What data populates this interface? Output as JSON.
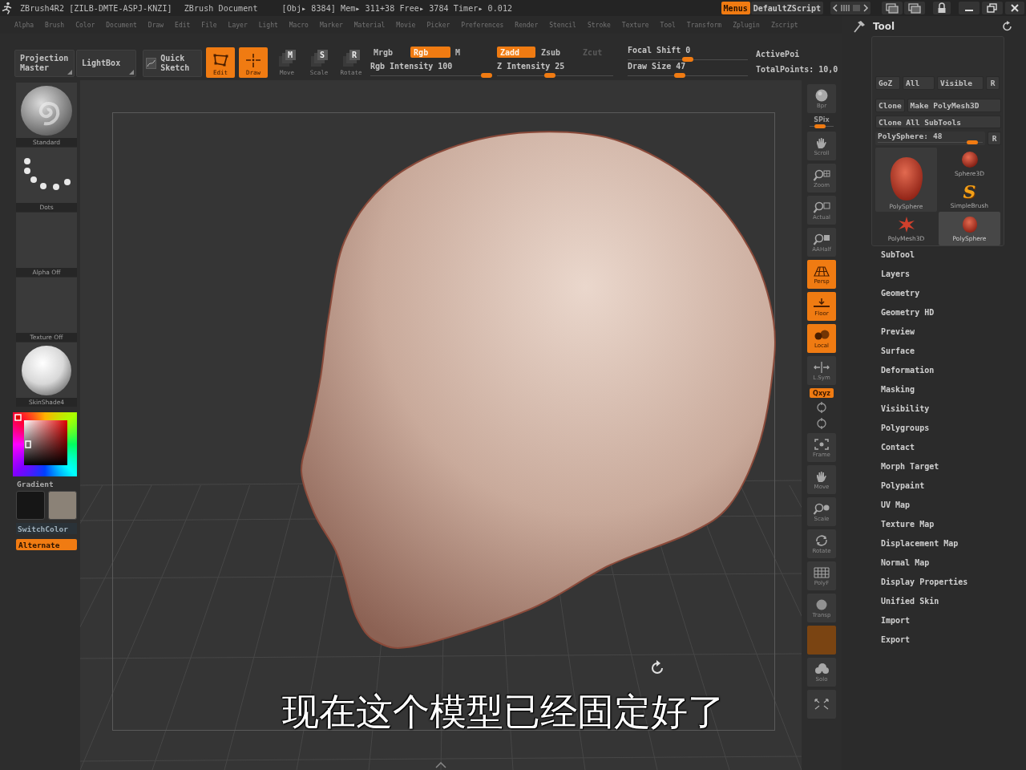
{
  "title_bar": {
    "app_title": "ZBrush4R2 [ZILB-DMTE-ASPJ-KNZI]",
    "document": "ZBrush Document",
    "stats": "[Obj▸ 8384] Mem▸ 311+38 Free▸ 3784 Timer▸ 0.012",
    "menus_toggle": {
      "label": "Menus",
      "on": true
    },
    "script_button": "DefaultZScript"
  },
  "menu_bar": [
    "Alpha",
    "Brush",
    "Color",
    "Document",
    "Draw",
    "Edit",
    "File",
    "Layer",
    "Light",
    "Macro",
    "Marker",
    "Material",
    "Movie",
    "Picker",
    "Preferences",
    "Render",
    "Stencil",
    "Stroke",
    "Texture",
    "Tool",
    "Transform",
    "Zplugin",
    "Zscript"
  ],
  "top_shelf": {
    "buttons": [
      {
        "kind": "panel",
        "label": "Projection Master"
      },
      {
        "kind": "panel",
        "label": "LightBox"
      },
      {
        "kind": "sketch",
        "label": "Quick Sketch"
      },
      {
        "kind": "mode",
        "label": "Edit",
        "on": true
      },
      {
        "kind": "mode",
        "label": "Draw",
        "on": true
      },
      {
        "kind": "transform",
        "glyph": "M",
        "label": "Move",
        "on": false
      },
      {
        "kind": "transform",
        "glyph": "S",
        "label": "Scale",
        "on": false
      },
      {
        "kind": "transform",
        "glyph": "R",
        "label": "Rotate",
        "on": false
      }
    ],
    "color_mode": {
      "toggles": [
        {
          "label": "Mrgb",
          "on": false
        },
        {
          "label": "Rgb",
          "on": true
        },
        {
          "label": "M",
          "on": false
        }
      ],
      "slider": {
        "label": "Rgb Intensity",
        "value": "100",
        "level": 1
      }
    },
    "depth_mode": {
      "toggles": [
        {
          "label": "Zadd",
          "on": true,
          "disabled": false
        },
        {
          "label": "Zsub",
          "on": false,
          "disabled": false
        },
        {
          "label": "Zcut",
          "on": false,
          "disabled": true
        }
      ],
      "slider": {
        "label": "Z Intensity",
        "value": "25",
        "level": 0.45
      }
    },
    "brush_sliders": [
      {
        "label": "Focal Shift",
        "value": "0",
        "level": 0.5
      },
      {
        "label": "Draw Size",
        "value": "47",
        "level": 0.43
      }
    ],
    "points": [
      "ActivePoi",
      "TotalPoints: 10,0"
    ]
  },
  "left_shelf": {
    "thumbnails": [
      {
        "kind": "brush",
        "label": "Standard"
      },
      {
        "kind": "stroke",
        "label": "Dots"
      },
      {
        "kind": "alpha",
        "label": "Alpha Off"
      },
      {
        "kind": "texture",
        "label": "Texture Off"
      },
      {
        "kind": "material",
        "label": "SkinShade4"
      }
    ],
    "gradient_button": "Gradient",
    "swatches": [
      {
        "color": "#161616"
      },
      {
        "color": "#8b8277"
      }
    ],
    "switch_color_button": "SwitchColor",
    "alternate_toggle": {
      "label": "Alternate",
      "on": true
    }
  },
  "canvas": {
    "subtitle": "现在这个模型已经固定好了"
  },
  "right_toolbar": [
    {
      "kind": "tile",
      "label": "Bpr",
      "on": false
    },
    {
      "kind": "slider",
      "label": "SPix",
      "level": 0.4
    },
    {
      "kind": "tile",
      "label": "Scroll",
      "on": false
    },
    {
      "kind": "tile",
      "label": "Zoom",
      "on": false
    },
    {
      "kind": "tile",
      "label": "Actual",
      "on": false
    },
    {
      "kind": "tile",
      "label": "AAHalf",
      "on": false
    },
    {
      "kind": "tile",
      "label": "Persp",
      "on": true
    },
    {
      "kind": "tile",
      "label": "Floor",
      "on": true
    },
    {
      "kind": "tile",
      "label": "Local",
      "on": true
    },
    {
      "kind": "tile",
      "label": "L.Sym",
      "on": false
    },
    {
      "kind": "chip",
      "label": "Qxyz",
      "on": true
    },
    {
      "kind": "mini"
    },
    {
      "kind": "mini"
    },
    {
      "kind": "tile",
      "label": "Frame",
      "on": false
    },
    {
      "kind": "tile",
      "label": "Move",
      "on": false
    },
    {
      "kind": "tile",
      "label": "Scale",
      "on": false
    },
    {
      "kind": "tile",
      "label": "Rotate",
      "on": false
    },
    {
      "kind": "tile",
      "label": "PolyF",
      "on": false
    },
    {
      "kind": "tile",
      "label": "Transp",
      "on": false
    },
    {
      "kind": "blank",
      "on": true,
      "disabled": true
    },
    {
      "kind": "tile",
      "label": "Solo",
      "on": false
    },
    {
      "kind": "icon",
      "on": false
    }
  ],
  "tool_panel": {
    "title": "Tool",
    "top_buttons": [
      "GoZ",
      "All",
      "Visible",
      "R"
    ],
    "clone_row": [
      "Clone",
      "Make PolyMesh3D"
    ],
    "clone_all": "Clone All SubTools",
    "tool_slider": {
      "label": "PolySphere:",
      "value": "48",
      "level": 0.95
    },
    "reset_button": "R",
    "current_tool": {
      "label": "PolySphere"
    },
    "tools": [
      {
        "label": "Sphere3D",
        "selected": false
      },
      {
        "glyph": "S",
        "label": "SimpleBrush",
        "selected": false
      },
      {
        "label": "PolyMesh3D",
        "selected": false
      },
      {
        "label": "PolySphere",
        "selected": true
      }
    ],
    "sections": [
      "SubTool",
      "Layers",
      "Geometry",
      "Geometry HD",
      "Preview",
      "Surface",
      "Deformation",
      "Masking",
      "Visibility",
      "Polygroups",
      "Contact",
      "Morph Target",
      "Polypaint",
      "UV Map",
      "Texture Map",
      "Displacement Map",
      "Normal Map",
      "Display Properties",
      "Unified Skin",
      "Import",
      "Export"
    ]
  }
}
